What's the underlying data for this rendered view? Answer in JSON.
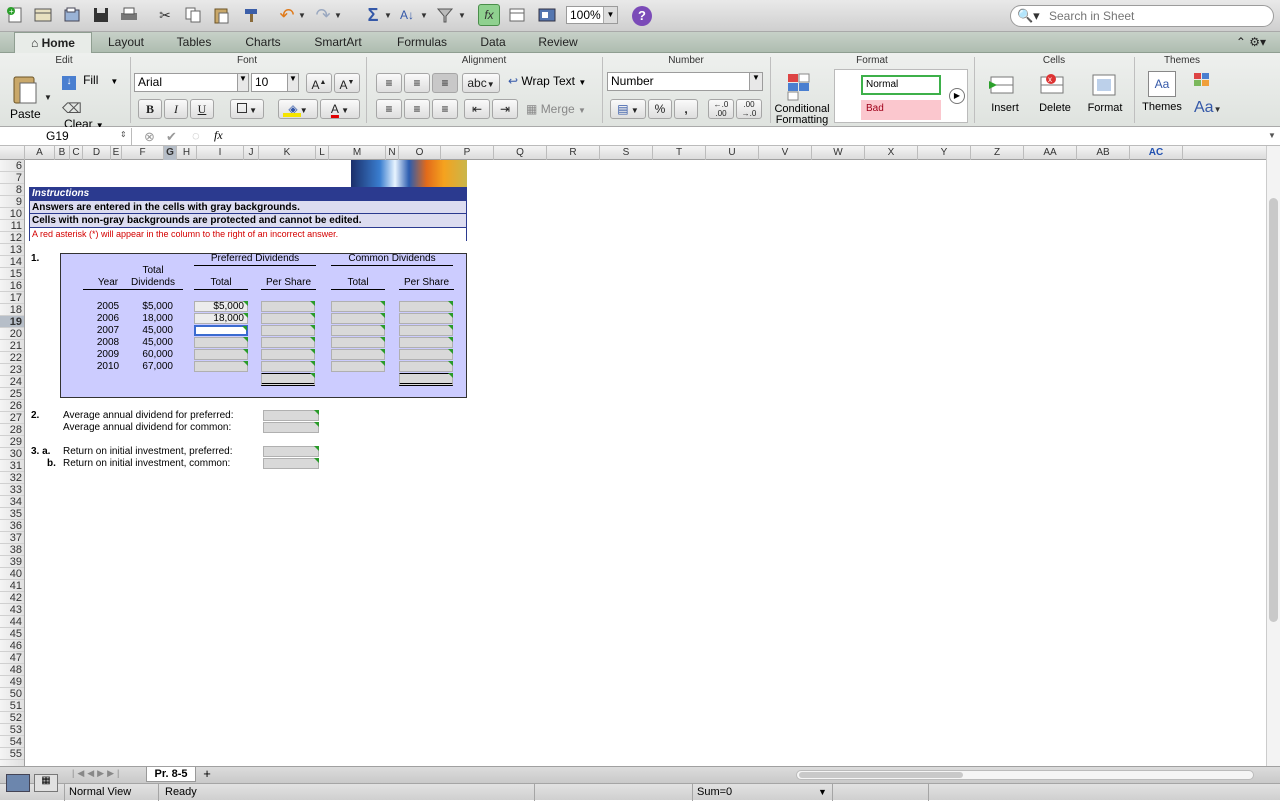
{
  "toolbar": {
    "zoom": "100%",
    "search_placeholder": "Search in Sheet"
  },
  "tabs": [
    "Home",
    "Layout",
    "Tables",
    "Charts",
    "SmartArt",
    "Formulas",
    "Data",
    "Review"
  ],
  "ribbon": {
    "groups": {
      "edit": "Edit",
      "font": "Font",
      "alignment": "Alignment",
      "number": "Number",
      "format": "Format",
      "cells": "Cells",
      "themes": "Themes"
    },
    "paste": "Paste",
    "fill": "Fill",
    "clear": "Clear",
    "font_name": "Arial",
    "font_size": "10",
    "wrap_text": "Wrap Text",
    "merge": "Merge",
    "abc": "abc",
    "number_format": "Number",
    "percent": "%",
    "comma": ",",
    "conditional_formatting_1": "Conditional",
    "conditional_formatting_2": "Formatting",
    "style_normal": "Normal",
    "style_bad": "Bad",
    "insert": "Insert",
    "delete": "Delete",
    "format": "Format",
    "themes": "Themes",
    "aa": "Aa"
  },
  "formula_bar": {
    "name_box": "G19",
    "fx": "fx",
    "content": ""
  },
  "columns": [
    "A",
    "B",
    "C",
    "D",
    "E",
    "F",
    "G",
    "H",
    "I",
    "J",
    "K",
    "L",
    "M",
    "N",
    "O",
    "P",
    "Q",
    "R",
    "S",
    "T",
    "U",
    "V",
    "W",
    "X",
    "Y",
    "Z",
    "AA",
    "AB",
    "AC"
  ],
  "rows": [
    "6",
    "7",
    "8",
    "9",
    "10",
    "11",
    "12",
    "13",
    "14",
    "15",
    "16",
    "17",
    "18",
    "19",
    "20",
    "21",
    "22",
    "23",
    "24",
    "25",
    "26",
    "27",
    "28",
    "29",
    "30",
    "31",
    "32",
    "33",
    "34",
    "35",
    "36",
    "37",
    "38",
    "39",
    "40",
    "41",
    "42",
    "43",
    "44",
    "45",
    "46",
    "47",
    "48",
    "49",
    "50",
    "51",
    "52",
    "53",
    "54",
    "55"
  ],
  "sheet": {
    "instructions_title": "Instructions",
    "instr_1": "Answers are entered in the cells with gray backgrounds.",
    "instr_2": "Cells with non-gray backgrounds are protected and cannot be edited.",
    "instr_3": "A red asterisk (*) will appear in the column to the right of an incorrect answer.",
    "q1": "1.",
    "hdr_preferred": "Preferred Dividends",
    "hdr_common": "Common Dividends",
    "hdr_total_div_1": "Total",
    "hdr_total_div_2": "Dividends",
    "hdr_year": "Year",
    "hdr_total": "Total",
    "hdr_per_share": "Per Share",
    "hdr_total_c": "Total",
    "hdr_per_share_c": "Per Share",
    "years": [
      "2005",
      "2006",
      "2007",
      "2008",
      "2009",
      "2010"
    ],
    "dividends": [
      "$5,000",
      "18,000",
      "45,000",
      "45,000",
      "60,000",
      "67,000"
    ],
    "pref_totals": [
      "$5,000",
      "18,000",
      "",
      "",
      "",
      ""
    ],
    "q2": "2.",
    "q2_pref": "Average annual dividend for preferred:",
    "q2_common": "Average annual dividend for common:",
    "q3a": "3. a.",
    "q3a_text": "Return on initial investment, preferred:",
    "q3b": "b.",
    "q3b_text": "Return on initial investment, common:"
  },
  "sheet_tabs": {
    "active": "Pr. 8-5",
    "add": "+"
  },
  "status": {
    "view": "Normal View",
    "ready": "Ready",
    "sum": "Sum=0"
  },
  "colors": {
    "instructions_bg": "#2b3a8f",
    "input_gray": "#d9d9d9",
    "table_bg": "#ccccff",
    "error_red": "#d40000",
    "marker_green": "#2a9b2a"
  }
}
